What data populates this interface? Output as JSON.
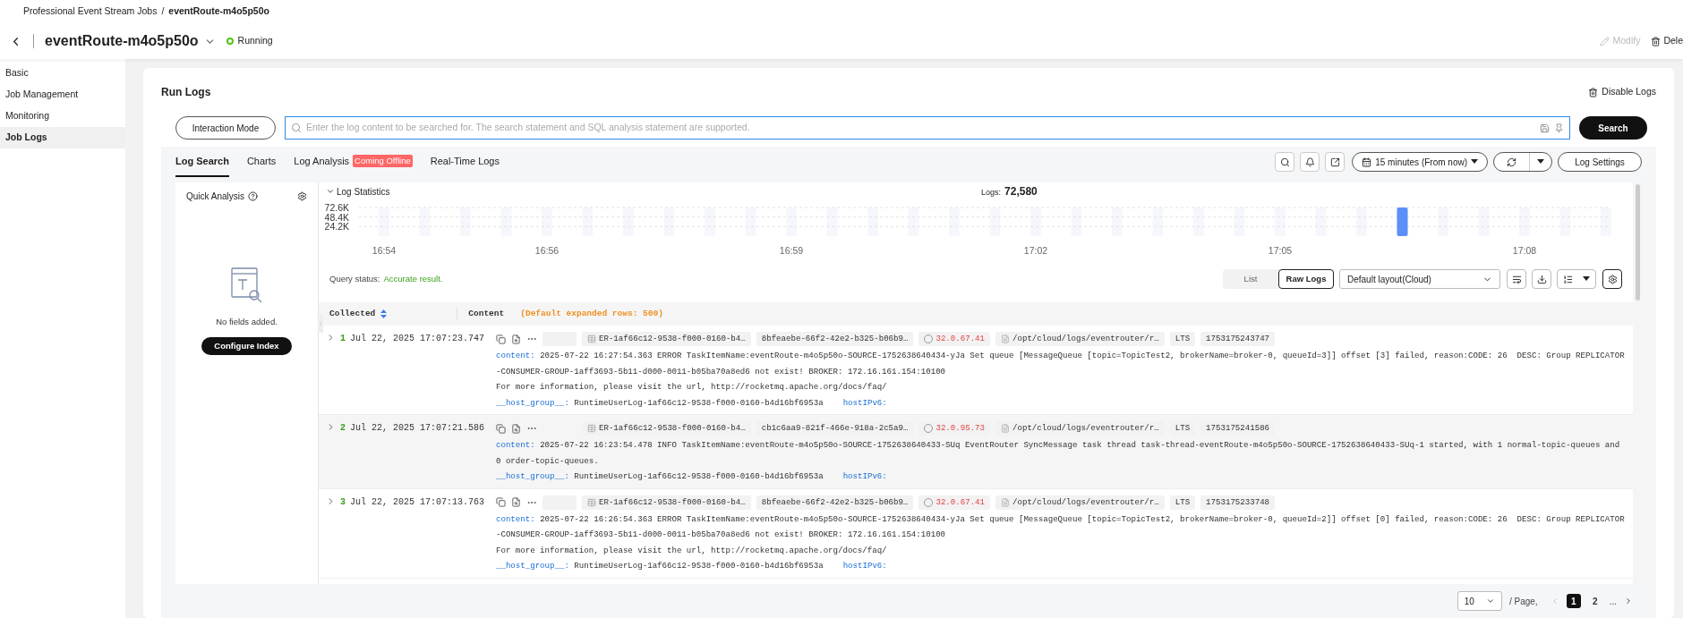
{
  "breadcrumb": {
    "parent": "Professional Event Stream Jobs",
    "separator": "/",
    "current": "eventRoute-m4o5p50o"
  },
  "header": {
    "title": "eventRoute-m4o5p50o",
    "status": "Running",
    "actions": [
      {
        "label": "Modify",
        "disabled": true
      },
      {
        "label": "Dele",
        "disabled": false
      }
    ]
  },
  "sidebar": {
    "items": [
      {
        "label": "Basic",
        "selected": false
      },
      {
        "label": "Job Management",
        "selected": false
      },
      {
        "label": "Monitoring",
        "selected": false
      },
      {
        "label": "Job Logs",
        "selected": true
      }
    ]
  },
  "page": {
    "title": "Run Logs",
    "disable_action": "Disable Logs"
  },
  "search": {
    "mode_button": "Interaction Mode",
    "placeholder": "Enter the log content to be searched for. The search statement and SQL analysis statement are supported.",
    "button": "Search"
  },
  "tabs": [
    {
      "label": "Log Search",
      "selected": true
    },
    {
      "label": "Charts",
      "selected": false
    },
    {
      "label": "Log Analysis",
      "selected": false,
      "badge": "Coming Offline"
    },
    {
      "label": "Real-Time Logs",
      "selected": false
    }
  ],
  "toolbar": {
    "time_range": "15 minutes (From now)",
    "settings": "Log Settings"
  },
  "quick_analysis": {
    "title": "Quick Analysis",
    "empty_text": "No fields added.",
    "button": "Configure Index"
  },
  "statistics": {
    "title": "Log Statistics",
    "count_label": "Logs:",
    "count": "72,580",
    "chart_data": {
      "type": "bar",
      "categories": [
        "16:54",
        null,
        null,
        null,
        "16:56",
        null,
        null,
        null,
        null,
        null,
        "16:59",
        null,
        null,
        null,
        null,
        null,
        "17:02",
        null,
        null,
        null,
        null,
        null,
        "17:05",
        null,
        null,
        null,
        null,
        null,
        "17:08",
        null,
        null
      ],
      "values": [
        0,
        0,
        0,
        0,
        0,
        0,
        0,
        0,
        0,
        0,
        0,
        0,
        0,
        0,
        0,
        0,
        0,
        0,
        0,
        0,
        0,
        0,
        0,
        0,
        0,
        72600,
        0,
        0,
        0,
        0,
        0
      ],
      "ylim": [
        0,
        72600
      ],
      "yticks": [
        {
          "value": 24200,
          "label": "24.2K"
        },
        {
          "value": 48400,
          "label": "48.4K"
        },
        {
          "value": 72600,
          "label": "72.6K"
        }
      ]
    }
  },
  "query": {
    "label": "Query status:",
    "result": "Accurate result.",
    "views": [
      {
        "label": "List",
        "selected": false
      },
      {
        "label": "Raw Logs",
        "selected": true
      }
    ],
    "layout": "Default layout(Cloud)"
  },
  "table": {
    "columns": [
      "Collected",
      "Content"
    ],
    "content_hint": "(Default expanded rows: 500)",
    "rows": [
      {
        "index": "1",
        "time": "Jul 22, 2025 17:07:23.747",
        "blank_tag": true,
        "tags": [
          {
            "kind": "table",
            "text": "ER-1af66c12-9538-f000-0160-b4…"
          },
          {
            "kind": "plain",
            "text": "8bfeaebe-66f2-42e2-b325-b06b9…"
          },
          {
            "kind": "ip",
            "text": "32.0.67.41"
          },
          {
            "kind": "file",
            "text": "/opt/cloud/logs/eventrouter/r…"
          },
          {
            "kind": "plain",
            "text": "LTS"
          },
          {
            "kind": "plain",
            "text": "1753175243747"
          }
        ],
        "content_label": "content:",
        "content": [
          "2025-07-22 16:27:54.363 ERROR TaskItemName:eventRoute-m4o5p50o-SOURCE-1752638640434-yJa Set queue [MessageQueue [topic=TopicTest2, brokerName=broker-0, queueId=3]] offset [3] failed, reason:CODE: 26  DESC: Group REPLICATOR-CONSUMER-GROUP-1aff3693-5b11-d000-0011-b05ba70a8ed6 not exist! BROKER: 172.16.161.154:10100",
          "For more information, please visit the url, http://rocketmq.apache.org/docs/faq/"
        ],
        "host_label": "__host_group__:",
        "host_value": "RuntimeUserLog-1af66c12-9538-f000-0160-b4d16bf6953a",
        "ipv6_label": "hostIPv6:"
      },
      {
        "index": "2",
        "time": "Jul 22, 2025 17:07:21.586",
        "blank_tag": false,
        "tags": [
          {
            "kind": "table",
            "text": "ER-1af66c12-9538-f000-0160-b4…"
          },
          {
            "kind": "plain",
            "text": "cb1c6aa9-821f-466e-918a-2c5a9…"
          },
          {
            "kind": "ip",
            "text": "32.0.95.73"
          },
          {
            "kind": "file",
            "text": "/opt/cloud/logs/eventrouter/r…"
          },
          {
            "kind": "plain",
            "text": "LTS"
          },
          {
            "kind": "plain",
            "text": "1753175241586"
          }
        ],
        "content_label": "content:",
        "content": [
          "2025-07-22 16:23:54.478 INFO TaskItemName:eventRoute-m4o5p50o-SOURCE-1752638640433-SUq EventRouter SyncMessage task thread task-thread-eventRoute-m4o5p50o-SOURCE-1752638640433-SUq-1 started, with 1 normal-topic-queues and 0 order-topic-queues."
        ],
        "host_label": "__host_group__:",
        "host_value": "RuntimeUserLog-1af66c12-9538-f000-0160-b4d16bf6953a",
        "ipv6_label": "hostIPv6:"
      },
      {
        "index": "3",
        "time": "Jul 22, 2025 17:07:13.763",
        "blank_tag": true,
        "tags": [
          {
            "kind": "table",
            "text": "ER-1af66c12-9538-f000-0160-b4…"
          },
          {
            "kind": "plain",
            "text": "8bfeaebe-66f2-42e2-b325-b06b9…"
          },
          {
            "kind": "ip",
            "text": "32.0.67.41"
          },
          {
            "kind": "file",
            "text": "/opt/cloud/logs/eventrouter/r…"
          },
          {
            "kind": "plain",
            "text": "LTS"
          },
          {
            "kind": "plain",
            "text": "1753175233748"
          }
        ],
        "content_label": "content:",
        "content": [
          "2025-07-22 16:26:54.363 ERROR TaskItemName:eventRoute-m4o5p50o-SOURCE-1752638640434-yJa Set queue [MessageQueue [topic=TopicTest2, brokerName=broker-0, queueId=2]] offset [0] failed, reason:CODE: 26  DESC: Group REPLICATOR-CONSUMER-GROUP-1aff3693-5b11-d000-0011-b05ba70a8ed6 not exist! BROKER: 172.16.161.154:10100",
          "For more information, please visit the url, http://rocketmq.apache.org/docs/faq/"
        ],
        "host_label": "__host_group__:",
        "host_value": "RuntimeUserLog-1af66c12-9538-f000-0160-b4d16bf6953a",
        "ipv6_label": "hostIPv6:"
      }
    ]
  },
  "pagination": {
    "page_size": "10",
    "per_page": "/ Page,",
    "pages": [
      {
        "label": "1",
        "selected": true
      },
      {
        "label": "2",
        "selected": false
      }
    ],
    "ellipsis": "..."
  }
}
